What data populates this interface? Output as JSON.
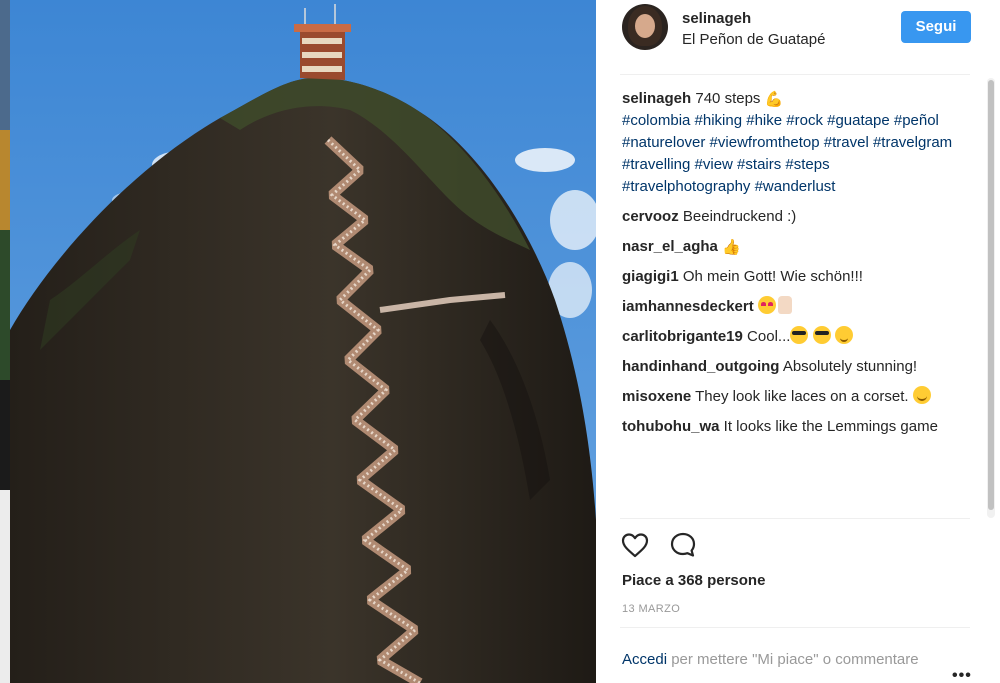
{
  "post": {
    "username": "selinageh",
    "location": "El Peñon de Guatapé",
    "follow_label": "Segui",
    "caption": {
      "author": "selinageh",
      "text": "740 steps",
      "emoji": "flexed-biceps",
      "hashtags": "#colombia #hiking #hike #rock #guatape #peñol #naturelover #viewfromthetop #travel #travelgram #travelling #view #stairs #steps #travelphotography #wanderlust"
    },
    "comments": [
      {
        "author": "cervooz",
        "text": "Beeindruckend :)"
      },
      {
        "author": "nasr_el_agha",
        "text": "",
        "emoji": "thumbs-up"
      },
      {
        "author": "giagigi1",
        "text": "Oh mein Gott! Wie schön!!!"
      },
      {
        "author": "iamhannesdeckert",
        "text": "",
        "emoji": "heart-eyes, thumbs-up"
      },
      {
        "author": "carlitobrigante19",
        "text": "Cool...",
        "emoji": "sunglasses, sunglasses, winking-face"
      },
      {
        "author": "handinhand_outgoing",
        "text": "Absolutely stunning!"
      },
      {
        "author": "misoxene",
        "text": "They look like laces on a corset.",
        "emoji": "smiling-face"
      },
      {
        "author": "tohubohu_wa",
        "text": "It looks like the Lemmings game"
      }
    ],
    "likes_text": "Piace a 368 persone",
    "date": "13 MARZO",
    "login_link": "Accedi",
    "login_text": "per mettere \"Mi piace\" o commentare",
    "more_icon": "•••"
  },
  "icons": {
    "like": "heart-outline-icon",
    "comment": "speech-bubble-icon",
    "more": "ellipsis-icon"
  },
  "colors": {
    "follow_button": "#3897f0",
    "hashtag": "#003569",
    "muted": "#999999",
    "sky": "#4a8fd6",
    "rock": "#2f2a22"
  }
}
